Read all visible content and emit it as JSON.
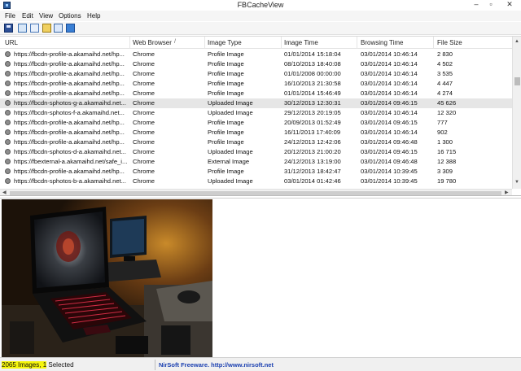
{
  "window": {
    "title": "FBCacheView",
    "minimize_glyph": "–",
    "maximize_glyph": "▫",
    "close_glyph": "✕"
  },
  "menu": [
    "File",
    "Edit",
    "View",
    "Options",
    "Help"
  ],
  "toolbar": {
    "icons": [
      "save-icon",
      "copy-icon",
      "properties-icon",
      "open-folder-icon",
      "html-report-icon",
      "exit-icon"
    ]
  },
  "columns": {
    "url": "URL",
    "browser": "Web Browser",
    "sort_indicator": "/",
    "image_type": "Image Type",
    "image_time": "Image Time",
    "browsing_time": "Browsing Time",
    "file_size": "File Size"
  },
  "rows": [
    {
      "url": "https://fbcdn-profile-a.akamaihd.net/hp...",
      "browser": "Chrome",
      "type": "Profile Image",
      "image_time": "01/01/2014 15:18:04",
      "browse_time": "03/01/2014 10:46:14",
      "size": "2 830",
      "selected": false
    },
    {
      "url": "https://fbcdn-profile-a.akamaihd.net/hp...",
      "browser": "Chrome",
      "type": "Profile Image",
      "image_time": "08/10/2013 18:40:08",
      "browse_time": "03/01/2014 10:46:14",
      "size": "4 502",
      "selected": false
    },
    {
      "url": "https://fbcdn-profile-a.akamaihd.net/hp...",
      "browser": "Chrome",
      "type": "Profile Image",
      "image_time": "01/01/2008 00:00:00",
      "browse_time": "03/01/2014 10:46:14",
      "size": "3 535",
      "selected": false
    },
    {
      "url": "https://fbcdn-profile-a.akamaihd.net/hp...",
      "browser": "Chrome",
      "type": "Profile Image",
      "image_time": "16/10/2013 21:30:58",
      "browse_time": "03/01/2014 10:46:14",
      "size": "4 447",
      "selected": false
    },
    {
      "url": "https://fbcdn-profile-a.akamaihd.net/hp...",
      "browser": "Chrome",
      "type": "Profile Image",
      "image_time": "01/01/2014 15:46:49",
      "browse_time": "03/01/2014 10:46:14",
      "size": "4 274",
      "selected": false
    },
    {
      "url": "https://fbcdn-sphotos-g-a.akamaihd.net...",
      "browser": "Chrome",
      "type": "Uploaded Image",
      "image_time": "30/12/2013 12:30:31",
      "browse_time": "03/01/2014 09:46:15",
      "size": "45 626",
      "selected": true
    },
    {
      "url": "https://fbcdn-sphotos-f-a.akamaihd.net...",
      "browser": "Chrome",
      "type": "Uploaded Image",
      "image_time": "29/12/2013 20:19:05",
      "browse_time": "03/01/2014 10:46:14",
      "size": "12 320",
      "selected": false
    },
    {
      "url": "https://fbcdn-profile-a.akamaihd.net/hp...",
      "browser": "Chrome",
      "type": "Profile Image",
      "image_time": "20/09/2013 01:52:49",
      "browse_time": "03/01/2014 09:46:15",
      "size": "777",
      "selected": false
    },
    {
      "url": "https://fbcdn-profile-a.akamaihd.net/hp...",
      "browser": "Chrome",
      "type": "Profile Image",
      "image_time": "16/11/2013 17:40:09",
      "browse_time": "03/01/2014 10:46:14",
      "size": "902",
      "selected": false
    },
    {
      "url": "https://fbcdn-profile-a.akamaihd.net/hp...",
      "browser": "Chrome",
      "type": "Profile Image",
      "image_time": "24/12/2013 12:42:06",
      "browse_time": "03/01/2014 09:46:48",
      "size": "1 300",
      "selected": false
    },
    {
      "url": "https://fbcdn-sphotos-d-a.akamaihd.net...",
      "browser": "Chrome",
      "type": "Uploaded Image",
      "image_time": "20/12/2013 21:00:20",
      "browse_time": "03/01/2014 09:46:15",
      "size": "16 715",
      "selected": false
    },
    {
      "url": "https://fbexternal-a.akamaihd.net/safe_i...",
      "browser": "Chrome",
      "type": "External Image",
      "image_time": "24/12/2013 13:19:00",
      "browse_time": "03/01/2014 09:46:48",
      "size": "12 388",
      "selected": false
    },
    {
      "url": "https://fbcdn-profile-a.akamaihd.net/hp...",
      "browser": "Chrome",
      "type": "Profile Image",
      "image_time": "31/12/2013 18:42:47",
      "browse_time": "03/01/2014 10:39:45",
      "size": "3 309",
      "selected": false
    },
    {
      "url": "https://fbcdn-sphotos-b-a.akamaihd.net...",
      "browser": "Chrome",
      "type": "Uploaded Image",
      "image_time": "03/01/2014 01:42:46",
      "browse_time": "03/01/2014 10:39:45",
      "size": "19 780",
      "selected": false
    }
  ],
  "scrollbar": {
    "up": "▲",
    "down": "▼",
    "left": "◀",
    "right": "▶"
  },
  "preview": {
    "image_icon": "laptop-photo-image"
  },
  "status": {
    "count_highlight": "2065 Images, 1",
    "count_rest": " Selected",
    "link": "NirSoft Freeware.  http://www.nirsoft.net"
  },
  "colors": {
    "selected_row": "#e6e6e6",
    "status_highlight": "#f5f50a",
    "link": "#1a3fb0"
  }
}
